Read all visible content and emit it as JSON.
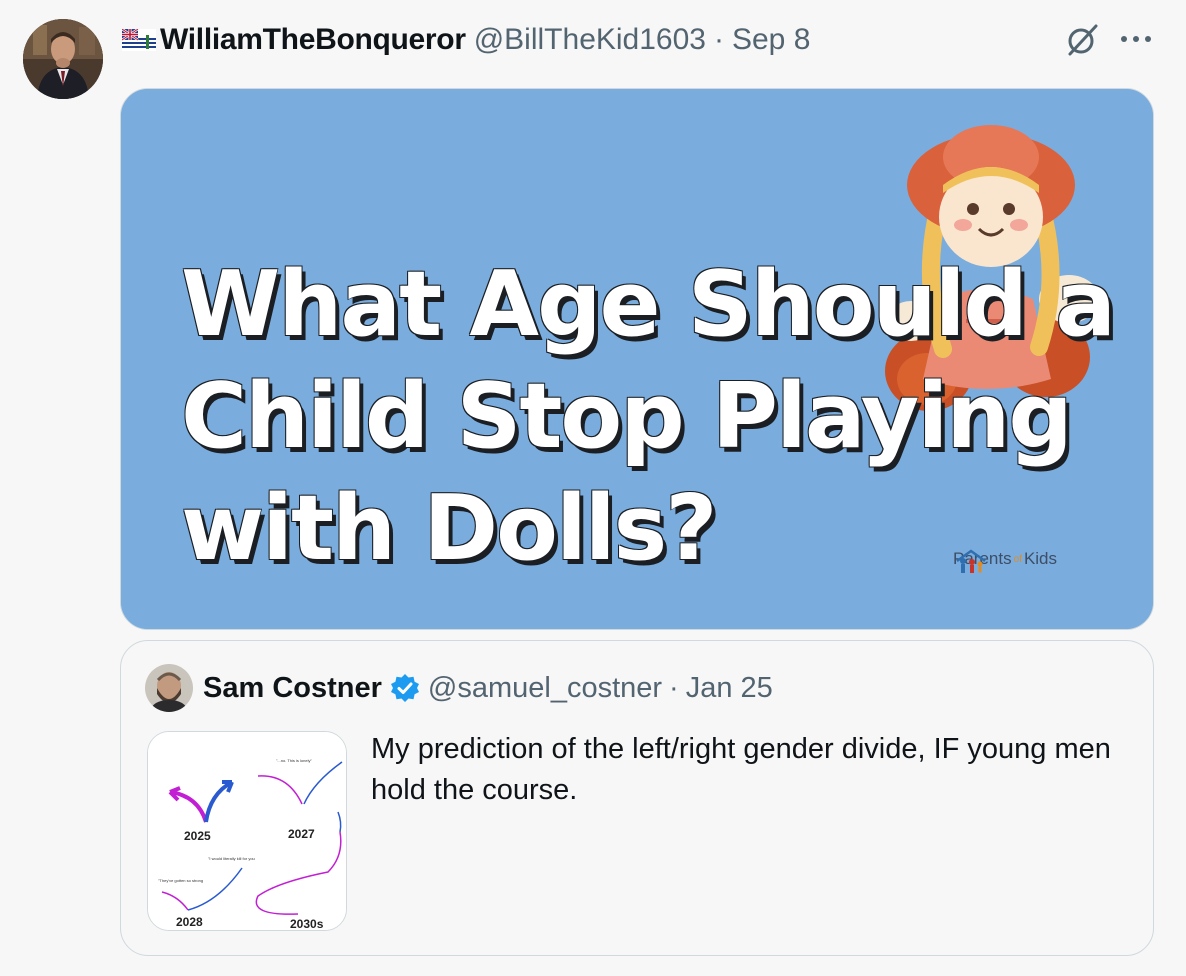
{
  "post": {
    "display_name": "WilliamTheBonqueror",
    "handle": "@BillTheKid1603",
    "separator": "·",
    "date": "Sep 8",
    "flag_icon": "british-indian-ocean-territory-flag-icon",
    "actions": {
      "grok_icon": "grok-icon",
      "more_icon": "more-icon"
    }
  },
  "media": {
    "headline_lines": [
      "What Age Should a",
      "Child Stop Playing",
      "with Dolls?"
    ],
    "brand_left": "Parents",
    "brand_mid": "of",
    "brand_right": "Kids",
    "background_color": "#7aaddd"
  },
  "quote": {
    "display_name": "Sam Costner",
    "handle": "@samuel_costner",
    "separator": "·",
    "date": "Jan 25",
    "verified_icon": "verified-badge-icon",
    "text": "My prediction of the left/right gender divide, IF young men hold the course.",
    "thumbnail_labels": [
      "2025",
      "2027",
      "2028",
      "2030s"
    ],
    "thumbnail_captions": [
      "\"...no. This is lonely\"",
      "\"I would literally kill for you to have babies and make you\"",
      "\"They've gotten so strong and mature. Kinda hot\""
    ]
  },
  "colors": {
    "text_primary": "#0f1419",
    "text_secondary": "#536471",
    "verified_blue": "#1d9bf0",
    "border": "#cfd9de"
  }
}
